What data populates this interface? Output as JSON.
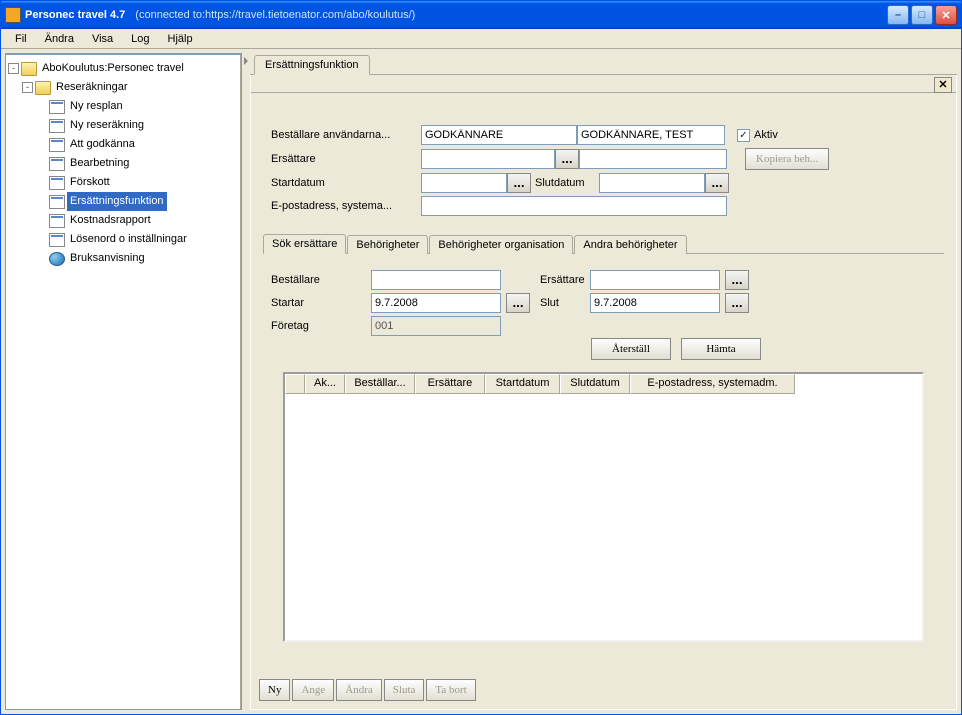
{
  "title": {
    "app": "Personec travel 4.7",
    "conn": "(connected to:https://travel.tietoenator.com/abo/koulutus/)"
  },
  "menu": {
    "fil": "Fil",
    "andra": "Ändra",
    "visa": "Visa",
    "log": "Log",
    "hjalp": "Hjälp"
  },
  "tree": {
    "root": "AboKoulutus:Personec travel",
    "reserakningar": "Reseräkningar",
    "items": [
      "Ny resplan",
      "Ny reseräkning",
      "Att godkänna",
      "Bearbetning",
      "Förskott",
      "Ersättningsfunktion",
      "Kostnadsrapport",
      "Lösenord o inställningar",
      "Bruksanvisning"
    ]
  },
  "main_tab": "Ersättningsfunktion",
  "form": {
    "bestallare_label": "Beställare användarna...",
    "bestallare_val1": "GODKÄNNARE",
    "bestallare_val2": "GODKÄNNARE, TEST",
    "aktiv_label": "Aktiv",
    "ersattare_label": "Ersättare",
    "startdatum_label": "Startdatum",
    "slutdatum_label": "Slutdatum",
    "epost_label": "E-postadress, systema...",
    "kopiera": "Kopiera beh..."
  },
  "inner_tabs": [
    "Sök ersättare",
    "Behörigheter",
    "Behörigheter organisation",
    "Andra behörigheter"
  ],
  "search": {
    "bestallare": "Beställare",
    "ersattare": "Ersättare",
    "startar": "Startar",
    "startar_val": "9.7.2008",
    "slut": "Slut",
    "slut_val": "9.7.2008",
    "foretag": "Företag",
    "foretag_val": "001",
    "aterstall": "Återställ",
    "hamta": "Hämta"
  },
  "grid": [
    "",
    "Ak...",
    "Beställar...",
    "Ersättare",
    "Startdatum",
    "Slutdatum",
    "E-postadress, systemadm."
  ],
  "bottom": [
    "Ny",
    "Ange",
    "Ändra",
    "Sluta",
    "Ta bort"
  ]
}
